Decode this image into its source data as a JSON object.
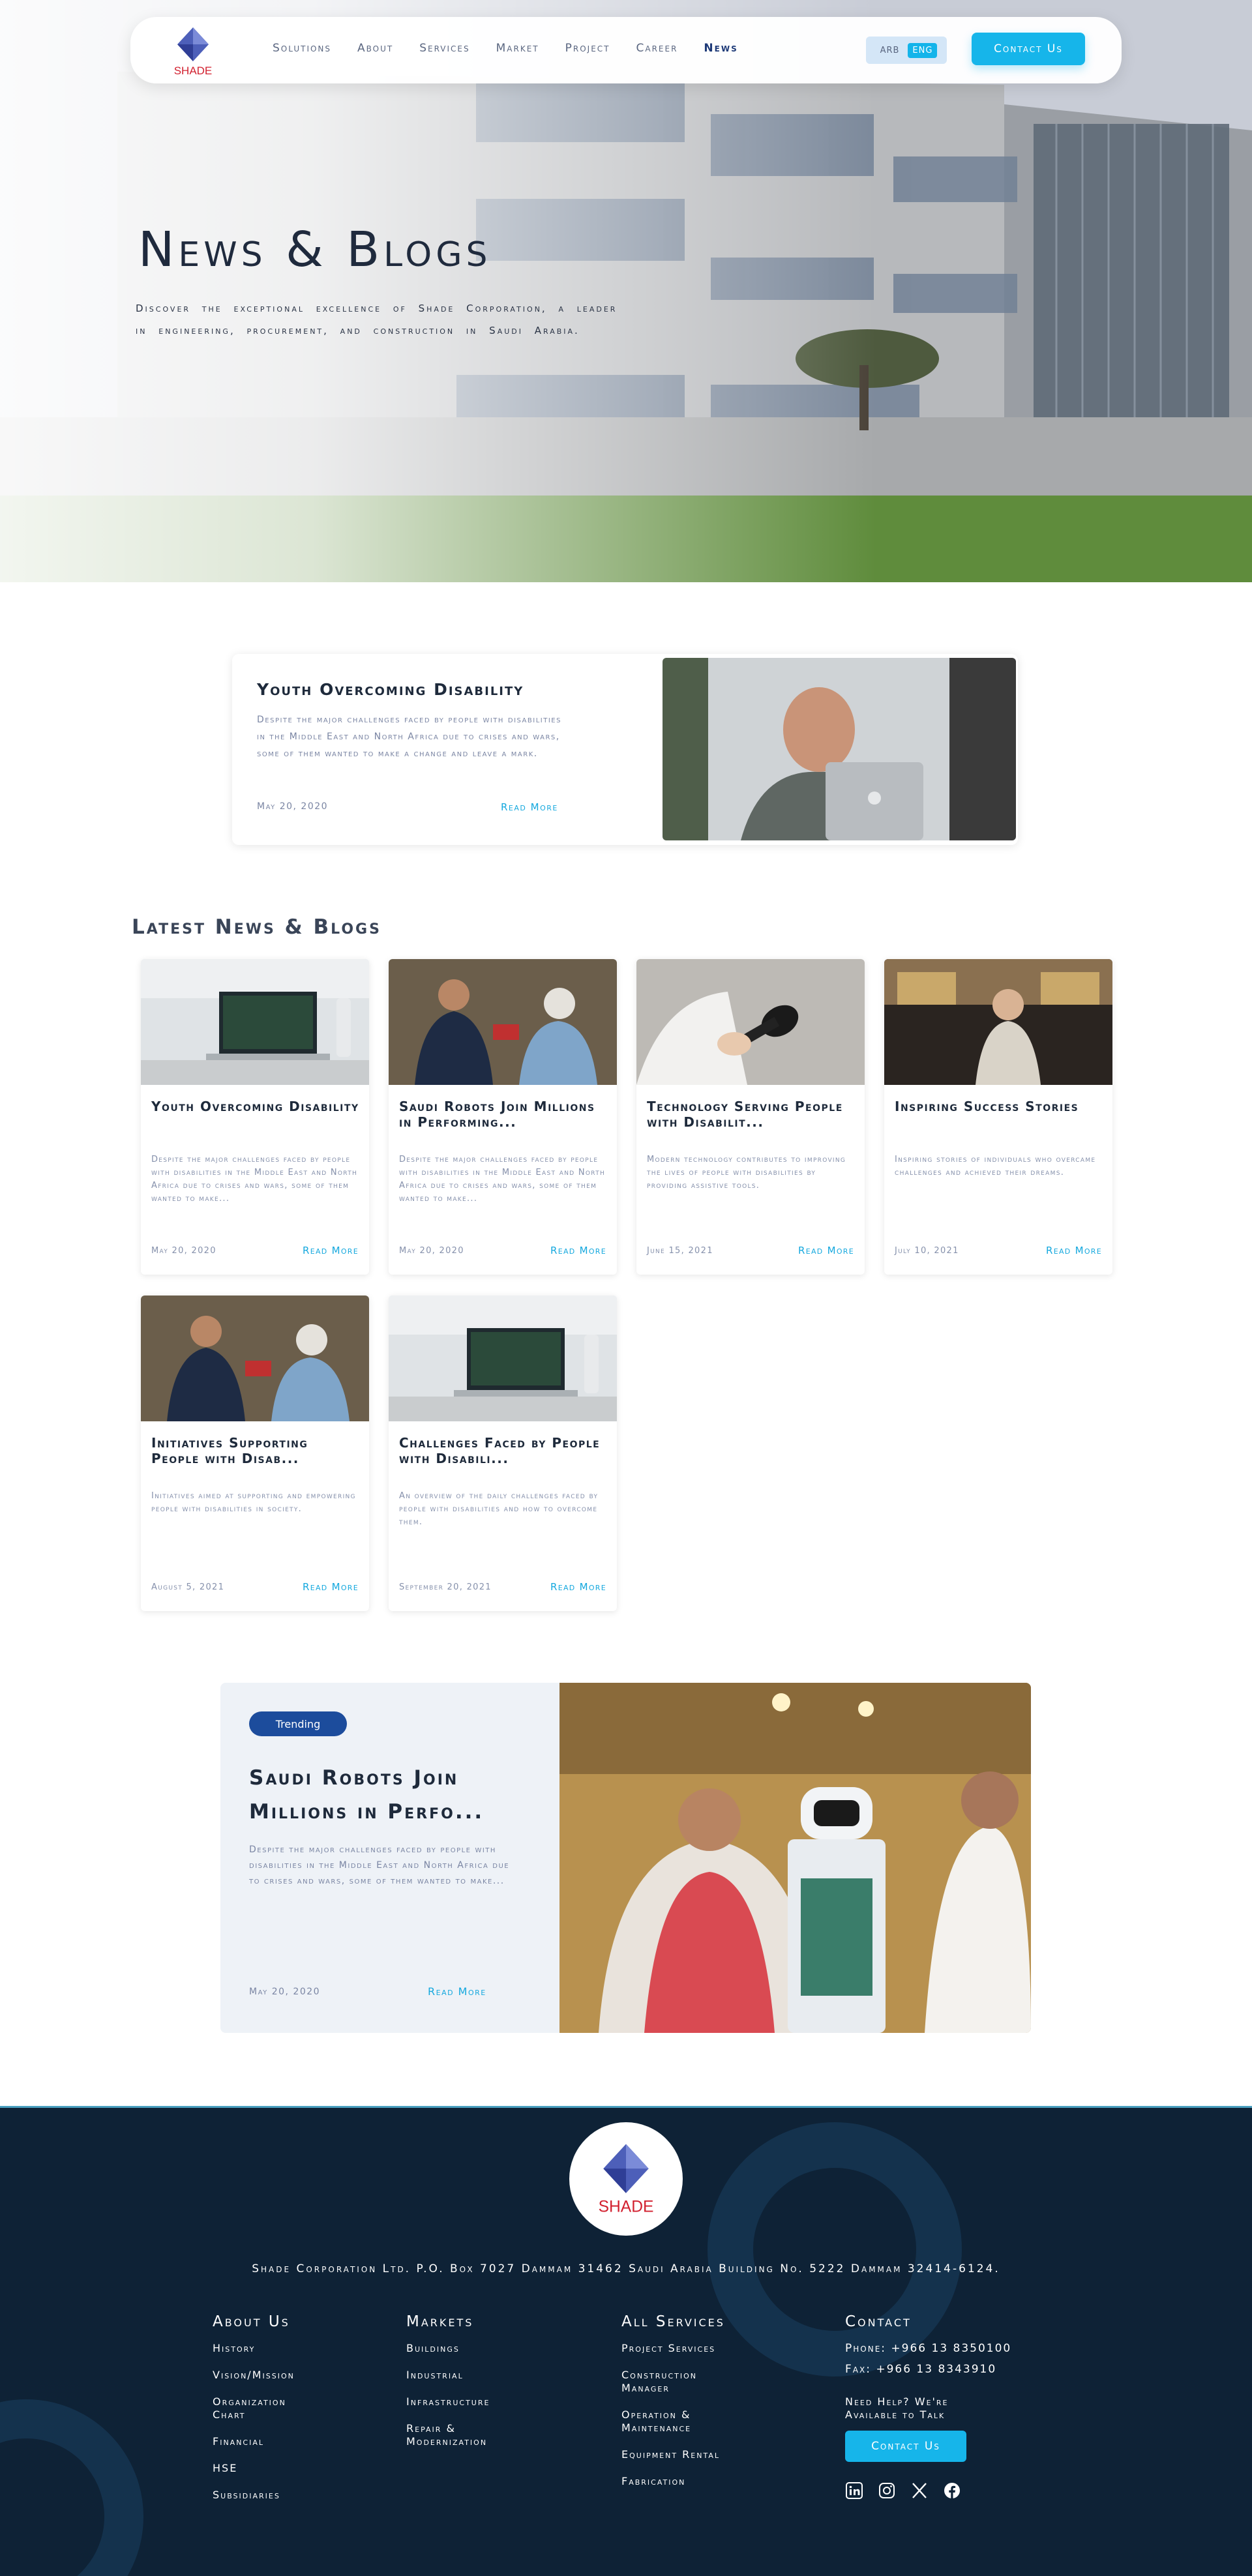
{
  "nav": {
    "logo_text": "SHADE",
    "links": [
      {
        "label": "Solutions"
      },
      {
        "label": "About"
      },
      {
        "label": "Services"
      },
      {
        "label": "Market"
      },
      {
        "label": "Project"
      },
      {
        "label": "Career"
      },
      {
        "label": "News"
      }
    ],
    "active": "News",
    "lang_arb": "ARB",
    "lang_eng": "ENG",
    "cta": "Contact Us"
  },
  "hero": {
    "title": "News & Blogs",
    "subtitle": "Discover the exceptional excellence of Shade Corporation, a leader in engineering, procurement, and construction in Saudi Arabia."
  },
  "featured": {
    "title": "Youth Overcoming Disability",
    "description": "Despite the major challenges faced by people with disabilities in the Middle East and North Africa due to crises and wars, some of them wanted to make a change and leave a mark.",
    "date": "May 20, 2020",
    "more": "Read More"
  },
  "latest": {
    "heading": "Latest News & Blogs",
    "cards": [
      {
        "title": "Youth Overcoming Disability",
        "desc": "Despite the major challenges faced by people with disabilities in the Middle East and North Africa due to crises and wars, some of them wanted to make...",
        "date": "May 20, 2020",
        "more": "Read More"
      },
      {
        "title": "Saudi Robots Join Millions in Performing...",
        "desc": "Despite the major challenges faced by people with disabilities in the Middle East and North Africa due to crises and wars, some of them wanted to make...",
        "date": "May 20, 2020",
        "more": "Read More"
      },
      {
        "title": "Technology Serving People with Disabilit...",
        "desc": "Modern technology contributes to improving the lives of people with disabilities by providing assistive tools.",
        "date": "June 15, 2021",
        "more": "Read More"
      },
      {
        "title": "Inspiring Success Stories",
        "desc": "Inspiring stories of individuals who overcame challenges and achieved their dreams.",
        "date": "July 10, 2021",
        "more": "Read More"
      },
      {
        "title": "Initiatives Supporting People with Disab...",
        "desc": "Initiatives aimed at supporting and empowering people with disabilities in society.",
        "date": "August 5, 2021",
        "more": "Read More"
      },
      {
        "title": "Challenges Faced by People with Disabili...",
        "desc": "An overview of the daily challenges faced by people with disabilities and how to overcome them.",
        "date": "September 20, 2021",
        "more": "Read More"
      }
    ]
  },
  "trending": {
    "badge": "Trending",
    "title": "Saudi Robots Join Millions in Perfo...",
    "description": "Despite the major challenges faced by people with disabilities in the Middle East and North Africa due to crises and wars, some of them wanted to make...",
    "date": "May 20, 2020",
    "more": "Read More"
  },
  "footer": {
    "logo_text": "SHADE",
    "address": "Shade Corporation Ltd. P.O. Box 7027 Dammam 31462 Saudi Arabia Building No. 5222 Dammam 32414-6124.",
    "about": {
      "heading": "About Us",
      "items": [
        "History",
        "Vision/Mission",
        "Organization Chart",
        "Financial",
        "HSE",
        "Subsidiaries"
      ]
    },
    "markets": {
      "heading": "Markets",
      "items": [
        "Buildings",
        "Industrial",
        "Infrastructure",
        "Repair & Modernization"
      ]
    },
    "services": {
      "heading": "All Services",
      "items": [
        "Project Services",
        "Construction Manager",
        "Operation & Maintenance",
        "Equipment Rental",
        "Fabrication"
      ]
    },
    "contact": {
      "heading": "Contact",
      "phone": "Phone: +966 13 8350100",
      "fax": "Fax: +966 13 8343910",
      "help": "Need Help? We're Available to Talk",
      "cta": "Contact Us"
    },
    "socials": [
      "linkedin-icon",
      "instagram-icon",
      "x-icon",
      "facebook-icon"
    ]
  },
  "colors": {
    "accent": "#16b5ea",
    "navy": "#0e2236",
    "badge": "#1c4c9c",
    "link": "#14a8de"
  }
}
